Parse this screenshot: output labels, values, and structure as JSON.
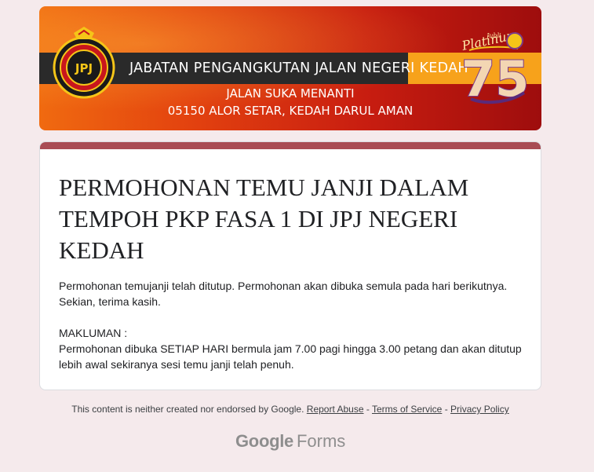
{
  "banner": {
    "agency_name": "JABATAN PENGANGKUTAN JALAN NEGERI KEDAH",
    "address_line1": "JALAN SUKA MENANTI",
    "address_line2": "05150 ALOR SETAR, KEDAH DARUL AMAN",
    "logo_text": "JPJ",
    "jubilee_script": "Platinum",
    "jubilee_small": "Jubli",
    "jubilee_number": "75"
  },
  "form": {
    "title": "PERMOHONAN TEMU JANJI DALAM TEMPOH PKP FASA 1 DI JPJ NEGERI KEDAH",
    "description": {
      "line1": "Permohonan temujanji telah ditutup. Permohonan akan dibuka semula pada hari berikutnya.",
      "line2": "Sekian, terima kasih.",
      "line3": "MAKLUMAN :",
      "line4": "Permohonan dibuka SETIAP HARI bermula jam 7.00 pagi hingga 3.00 petang dan akan ditutup lebih awal sekiranya sesi temu janji telah penuh."
    }
  },
  "footer": {
    "disclaimer": "This content is neither created nor endorsed by Google.",
    "separator": "-",
    "report_abuse": "Report Abuse",
    "terms": "Terms of Service",
    "privacy": "Privacy Policy"
  },
  "brand": {
    "google": "Google",
    "forms": "Forms"
  },
  "colors": {
    "page_background": "#f5eaec",
    "accent_bar": "#a94c54",
    "banner_orange": "#f06a10",
    "banner_red": "#c81d10"
  }
}
